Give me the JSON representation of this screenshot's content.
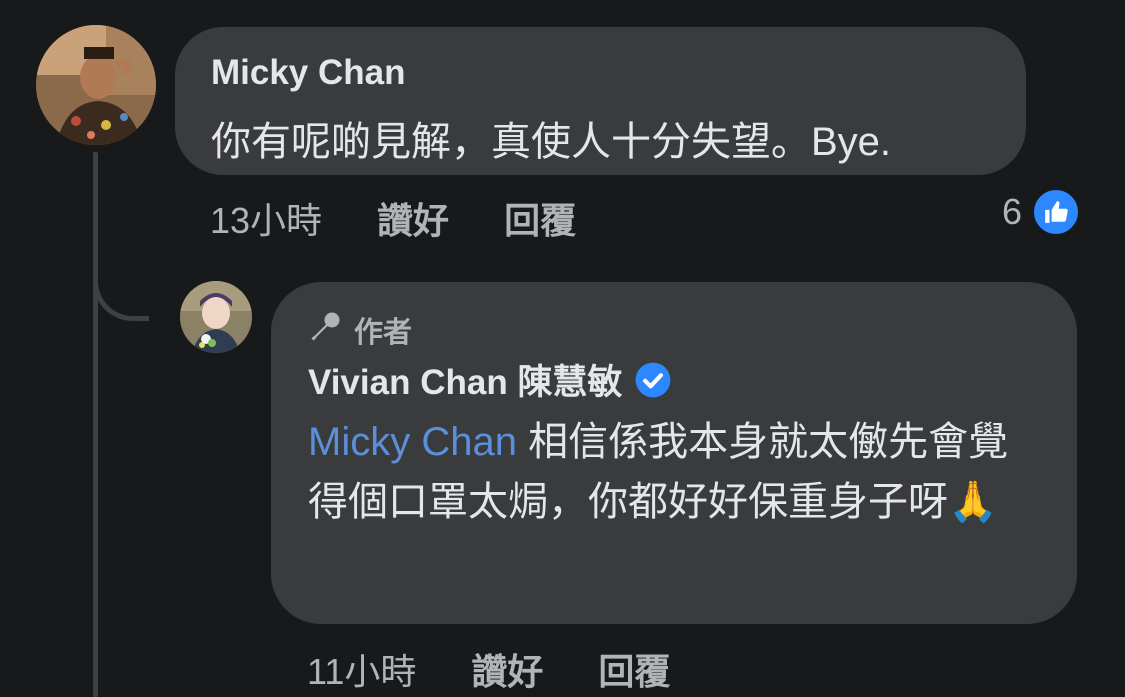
{
  "comments": [
    {
      "author": "Micky Chan",
      "text": "你有呢啲見解，真使人十分失望。Bye.",
      "time": "13小時",
      "like_label": "讚好",
      "reply_label": "回覆",
      "reaction_count": "6",
      "reaction_icon": "thumbs-up-icon"
    },
    {
      "author_tag": "作者",
      "author": "Vivian Chan 陳慧敏",
      "verified": true,
      "mention": "Micky Chan",
      "text": " 相信係我本身就太𠍁先會覺得個口罩太焗，你都好好保重身子呀",
      "emoji": "🙏",
      "time": "11小時",
      "like_label": "讚好",
      "reply_label": "回覆"
    }
  ],
  "colors": {
    "background": "#18191a",
    "bubble": "#3a3b3c",
    "text": "#e4e6eb",
    "secondary_text": "#b0b3b8",
    "mention": "#5b8fd9",
    "like_blue": "#2d88ff"
  }
}
